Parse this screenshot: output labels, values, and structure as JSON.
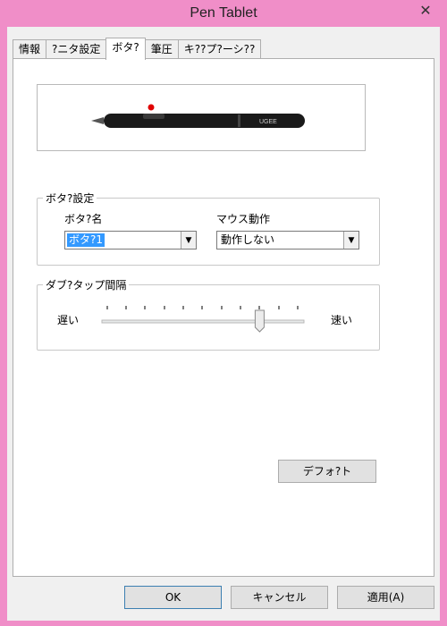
{
  "window": {
    "title": "Pen Tablet"
  },
  "tabs": [
    {
      "label": "情報"
    },
    {
      "label": "?ニタ設定"
    },
    {
      "label": "ボタ?"
    },
    {
      "label": "筆圧"
    },
    {
      "label": "キ??プ?ーシ??"
    }
  ],
  "active_tab": 2,
  "pen_image": {
    "brand": "UGEE",
    "marker_color": "#e00000"
  },
  "button_settings": {
    "legend": "ボタ?設定",
    "button_name_label": "ボタ?名",
    "button_name_value": "ボタ?1",
    "mouse_action_label": "マウス動作",
    "mouse_action_value": "動作しない"
  },
  "double_tap": {
    "legend": "ダブ?タップ間隔",
    "slow_label": "遅い",
    "fast_label": "速い",
    "level": 0.8
  },
  "default_button": "デフォ?ト",
  "footer": {
    "ok": "OK",
    "cancel": "キャンセル",
    "apply": "適用(A)"
  },
  "icons": {
    "close": "close-icon",
    "dropdown": "chevron-down-icon"
  }
}
